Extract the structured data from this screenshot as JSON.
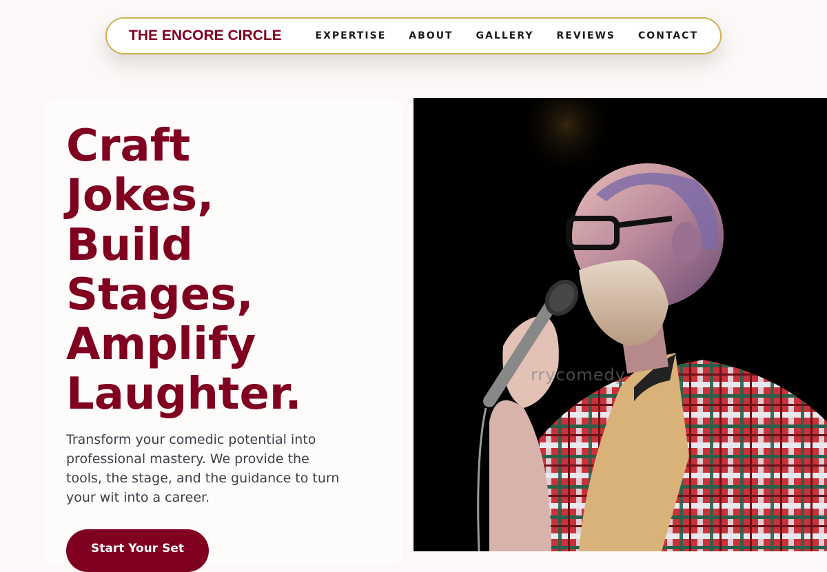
{
  "nav": {
    "brand": "THE ENCORE CIRCLE",
    "links": [
      "EXPERTISE",
      "ABOUT",
      "GALLERY",
      "REVIEWS",
      "CONTACT"
    ]
  },
  "hero": {
    "headline_lines": [
      "Craft",
      "Jokes,",
      "Build",
      "Stages,",
      "Amplify",
      "Laughter."
    ],
    "lede": "Transform your comedic potential into professional mastery. We provide the tools, the stage, and the guidance to turn your wit into a career.",
    "cta_label": "Start Your Set"
  },
  "photo": {
    "description_icon": "comedian-with-microphone-photo",
    "watermark": "rrycomedy"
  },
  "colors": {
    "brand": "#800020",
    "accent_border": "#cfb14e",
    "page_bg": "#fcf8f7"
  }
}
